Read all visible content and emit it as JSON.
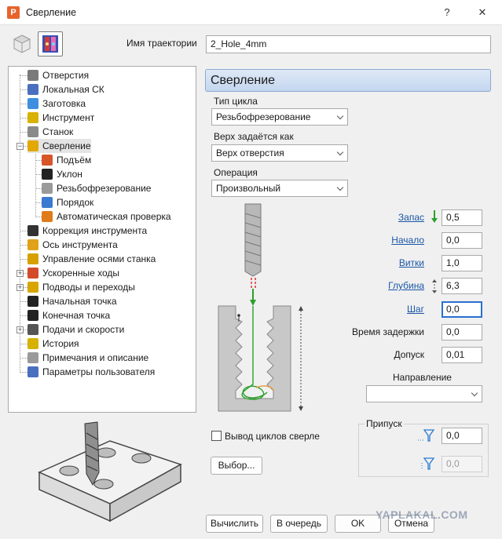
{
  "window": {
    "title": "Сверление",
    "help_label": "?",
    "close_label": "✕"
  },
  "toolpath_name": {
    "label": "Имя траектории",
    "value": "2_Hole_4mm"
  },
  "tree": {
    "items": [
      {
        "label": "Отверстия",
        "icon": "drill-holes-icon",
        "color": "#7a7a7a"
      },
      {
        "label": "Локальная СК",
        "icon": "local-cs-icon",
        "color": "#4a6fbf"
      },
      {
        "label": "Заготовка",
        "icon": "stock-icon",
        "color": "#3f8fe0"
      },
      {
        "label": "Инструмент",
        "icon": "tool-icon",
        "color": "#d9b100"
      },
      {
        "label": "Станок",
        "icon": "machine-icon",
        "color": "#8a8a8a"
      },
      {
        "label": "Сверление",
        "icon": "drilling-icon",
        "color": "#e2a800"
      },
      {
        "label": "Подъём",
        "icon": "retract-icon",
        "color": "#d6562a"
      },
      {
        "label": "Уклон",
        "icon": "slope-icon",
        "color": "#222222"
      },
      {
        "label": "Резьбофрезерование",
        "icon": "thread-mill-icon",
        "color": "#9a9a9a"
      },
      {
        "label": "Порядок",
        "icon": "order-icon",
        "color": "#3a7ad0"
      },
      {
        "label": "Автоматическая проверка",
        "icon": "auto-check-icon",
        "color": "#e07b1a"
      },
      {
        "label": "Коррекция инструмента",
        "icon": "tool-comp-icon",
        "color": "#333333"
      },
      {
        "label": "Ось инструмента",
        "icon": "tool-axis-icon",
        "color": "#e0a21a"
      },
      {
        "label": "Управление осями станка",
        "icon": "axis-control-icon",
        "color": "#d5a000"
      },
      {
        "label": "Ускоренные ходы",
        "icon": "rapid-moves-icon",
        "color": "#d34a2a"
      },
      {
        "label": "Подводы и переходы",
        "icon": "leads-links-icon",
        "color": "#d8a400"
      },
      {
        "label": "Начальная точка",
        "icon": "start-point-icon",
        "color": "#222222"
      },
      {
        "label": "Конечная точка",
        "icon": "end-point-icon",
        "color": "#222222"
      },
      {
        "label": "Подачи и скорости",
        "icon": "feeds-speeds-icon",
        "color": "#555555"
      },
      {
        "label": "История",
        "icon": "history-icon",
        "color": "#d6b100"
      },
      {
        "label": "Примечания и описание",
        "icon": "notes-icon",
        "color": "#9a9a9a"
      },
      {
        "label": "Параметры пользователя",
        "icon": "user-params-icon",
        "color": "#4a6fbf"
      }
    ]
  },
  "panel": {
    "title": "Сверление",
    "cycle_type": {
      "label": "Тип цикла",
      "value": "Резьбофрезерование"
    },
    "top_defined_as": {
      "label": "Верх задаётся как",
      "value": "Верх отверстия"
    },
    "operation": {
      "label": "Операция",
      "value": "Произвольный"
    },
    "params": [
      {
        "label": "Запас",
        "value": "0,5",
        "link": true
      },
      {
        "label": "Начало",
        "value": "0,0",
        "link": true
      },
      {
        "label": "Витки",
        "value": "1,0",
        "link": true
      },
      {
        "label": "Глубина",
        "value": "6,3",
        "link": true
      },
      {
        "label": "Шаг",
        "value": "0,0",
        "link": true
      },
      {
        "label": "Время задержки",
        "value": "0,0",
        "link": false
      },
      {
        "label": "Допуск",
        "value": "0,01",
        "link": false
      }
    ],
    "direction": {
      "label": "Направление",
      "value": ""
    },
    "drill_cycles_checkbox": {
      "label": "Вывод циклов сверле",
      "checked": false
    },
    "select_button": "Выбор...",
    "allowance": {
      "label": "Припуск",
      "value1": "0,0",
      "value2": "0,0"
    }
  },
  "footer": {
    "calculate": "Вычислить",
    "queue": "В очередь",
    "ok": "OK",
    "cancel": "Отмена",
    "watermark": "YAPLAKAL.COM"
  }
}
